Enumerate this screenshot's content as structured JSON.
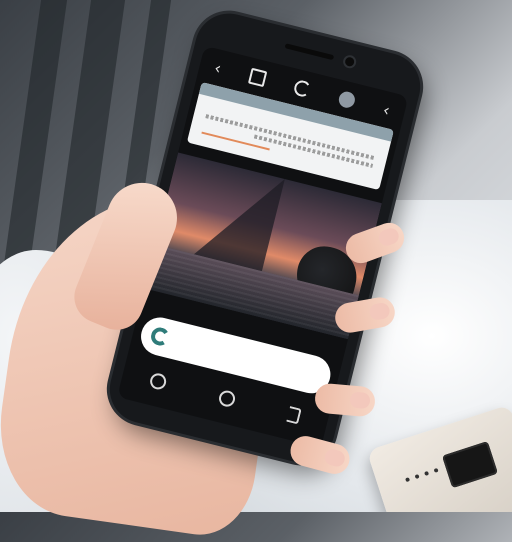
{
  "phone": {
    "top_icons": [
      "back-arrow-icon",
      "square-icon",
      "refresh-icon",
      "avatar-dot-icon",
      "chevron-left-icon"
    ],
    "bottom_nav": [
      "camera-circle-icon",
      "home-circle-icon",
      "back-icon"
    ]
  },
  "card": {
    "header_text": "",
    "body_text": ""
  },
  "bottom_bar": {
    "label": ""
  },
  "colors": {
    "phone_body": "#17191c",
    "card_header": "#8ea1ab",
    "bottom_bar_icon": "#2f7c7a",
    "photo_sunset": "#e08a68"
  }
}
